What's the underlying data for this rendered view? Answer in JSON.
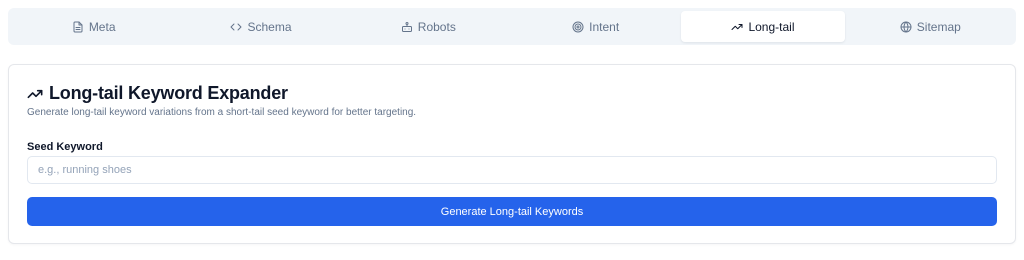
{
  "tabs": [
    {
      "label": "Meta",
      "icon": "document-icon",
      "active": false
    },
    {
      "label": "Schema",
      "icon": "code-icon",
      "active": false
    },
    {
      "label": "Robots",
      "icon": "robot-icon",
      "active": false
    },
    {
      "label": "Intent",
      "icon": "target-icon",
      "active": false
    },
    {
      "label": "Long-tail",
      "icon": "trending-up-icon",
      "active": true
    },
    {
      "label": "Sitemap",
      "icon": "globe-icon",
      "active": false
    }
  ],
  "card": {
    "title": "Long-tail Keyword Expander",
    "title_icon": "trending-up-icon",
    "description": "Generate long-tail keyword variations from a short-tail seed keyword for better targeting.",
    "field_label": "Seed Keyword",
    "input_value": "",
    "input_placeholder": "e.g., running shoes",
    "button_label": "Generate Long-tail Keywords"
  },
  "colors": {
    "accent": "#2563eb",
    "tabbar_bg": "#f1f5f9",
    "muted_text": "#64748b"
  }
}
